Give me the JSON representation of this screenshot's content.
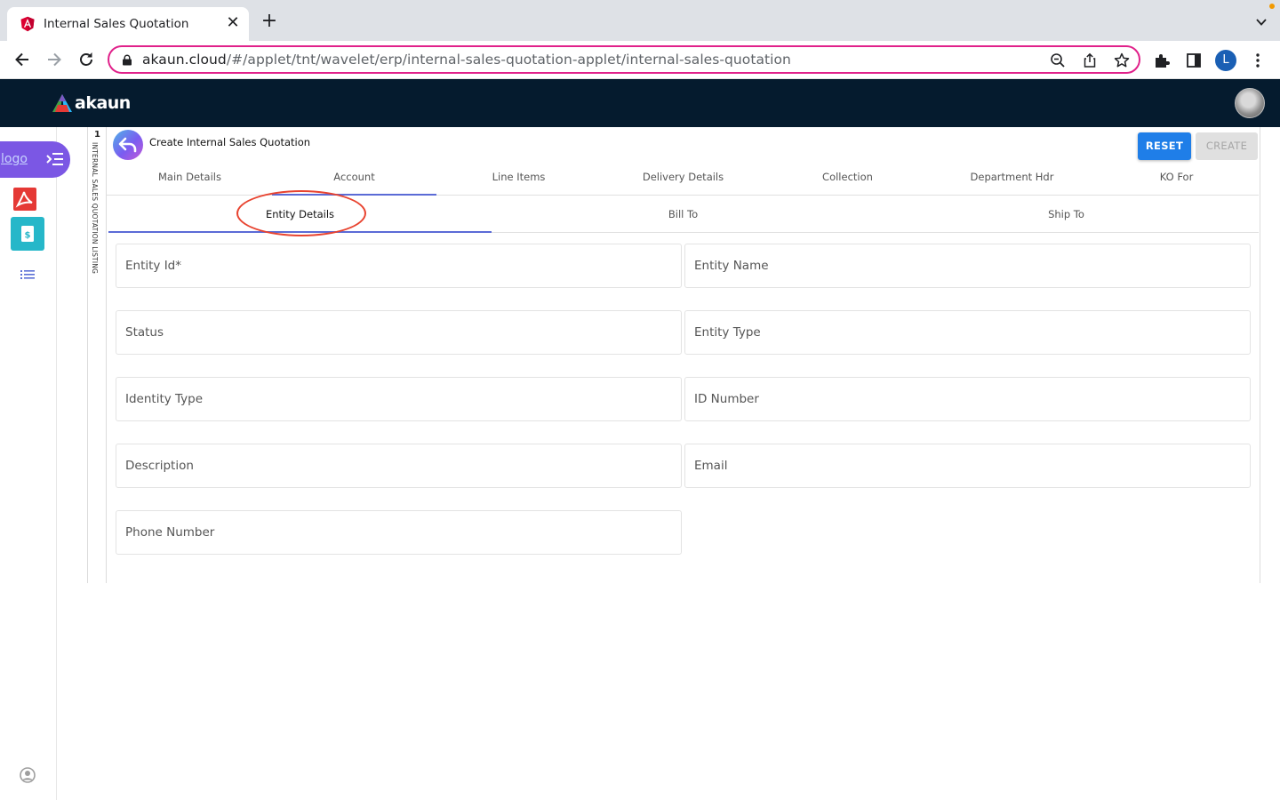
{
  "browser": {
    "tab_title": "Internal Sales Quotation",
    "url_host": "akaun.cloud",
    "url_path": "/#/applet/tnt/wavelet/erp/internal-sales-quotation-applet/internal-sales-quotation",
    "profile_initial": "L"
  },
  "app": {
    "brand_name": "akaun",
    "rail": {
      "logo_alt": "logo"
    },
    "listing": {
      "number": "1",
      "label": "INTERNAL SALES QUOTATION LISTING"
    },
    "page_title": "Create Internal Sales Quotation",
    "buttons": {
      "reset": "RESET",
      "create": "CREATE"
    },
    "main_tabs": [
      {
        "label": "Main Details"
      },
      {
        "label": "Account"
      },
      {
        "label": "Line Items"
      },
      {
        "label": "Delivery Details"
      },
      {
        "label": "Collection"
      },
      {
        "label": "Department Hdr"
      },
      {
        "label": "KO For"
      }
    ],
    "active_main_tab": "Account",
    "sub_tabs": [
      {
        "label": "Entity Details"
      },
      {
        "label": "Bill To"
      },
      {
        "label": "Ship To"
      }
    ],
    "active_sub_tab": "Entity Details",
    "fields": [
      {
        "label": "Entity Id*"
      },
      {
        "label": "Entity Name"
      },
      {
        "label": "Status"
      },
      {
        "label": "Entity Type"
      },
      {
        "label": "Identity Type"
      },
      {
        "label": "ID Number"
      },
      {
        "label": "Description"
      },
      {
        "label": "Email"
      },
      {
        "label": "Phone Number"
      }
    ]
  },
  "colors": {
    "header_bg": "#051b2e",
    "accent_purple": "#7b57e4",
    "reset_blue": "#1f7ee8",
    "tab_indicator": "#5b6bd6",
    "annotation_red": "#e8432f",
    "omnibox_border": "#e0218a"
  }
}
